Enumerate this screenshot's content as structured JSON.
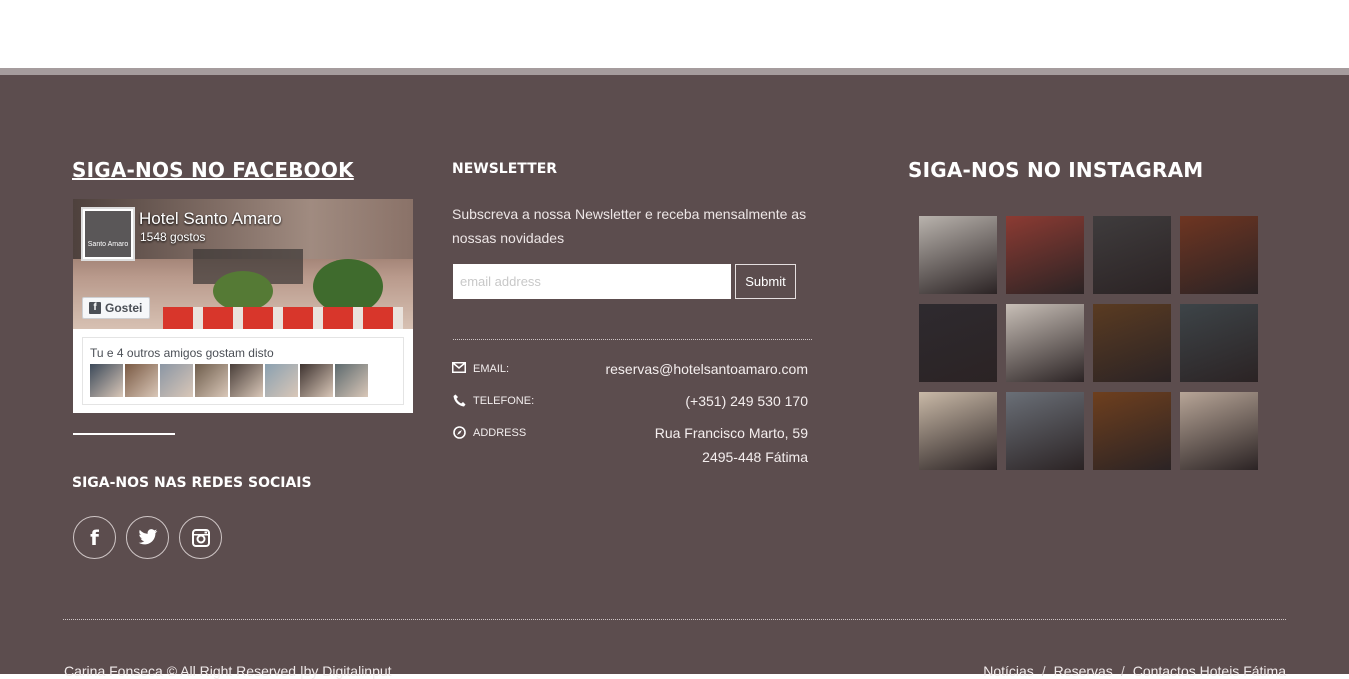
{
  "facebook": {
    "heading": "SIGA-NOS NO FACEBOOK",
    "page_name": "Hotel Santo Amaro",
    "likes": "1548 gostos",
    "like_button": "Gostei",
    "friends_text": "Tu e 4 outros amigos gostam disto",
    "logo_text": "Santo Amaro",
    "face_colors": [
      "#3c4a5a",
      "#7a5a44",
      "#8b96a4",
      "#6e5d4c",
      "#4a3f3a",
      "#8aa0b0",
      "#3e3330",
      "#5d6a6e"
    ]
  },
  "social": {
    "heading": "SIGA-NOS NAS REDES SOCIAIS",
    "icons": [
      {
        "name": "facebook-icon",
        "glyph": "f"
      },
      {
        "name": "twitter-icon",
        "glyph": "🐦"
      },
      {
        "name": "instagram-icon",
        "glyph": "◎"
      }
    ]
  },
  "newsletter": {
    "heading": "NEWSLETTER",
    "text": "Subscreva a nossa Newsletter e receba mensalmente as nossas novidades",
    "placeholder": "email address",
    "submit": "Submit"
  },
  "contacts": {
    "email_label": "EMAIL:",
    "email": "reservas@hotelsantoamaro.com",
    "phone_label": "TELEFONE:",
    "phone": "(+351) 249 530 170",
    "address_label": "ADDRESS",
    "address_line1": "Rua Francisco Marto, 59",
    "address_line2": "2495-448 Fátima"
  },
  "instagram": {
    "heading": "SIGA-NOS NO INSTAGRAM",
    "photo_colors": [
      "#b9b3ad",
      "#8c3b33",
      "#3f3c3d",
      "#6e3522",
      "#2e2a2f",
      "#c8bfb7",
      "#5a3b22",
      "#3d4448",
      "#c9b9a7",
      "#6a6f77",
      "#6e3f1e",
      "#b7a597"
    ]
  },
  "footer": {
    "copyright": "Carina Fonseca © All Right Reserved |by Digitalinput",
    "links": [
      "Notícias",
      "Reservas",
      "Contactos Hoteis Fátima"
    ],
    "separator": "/"
  },
  "colors": {
    "footer_bg": "#5c4d4e",
    "footer_top_border": "#a59c9d"
  }
}
